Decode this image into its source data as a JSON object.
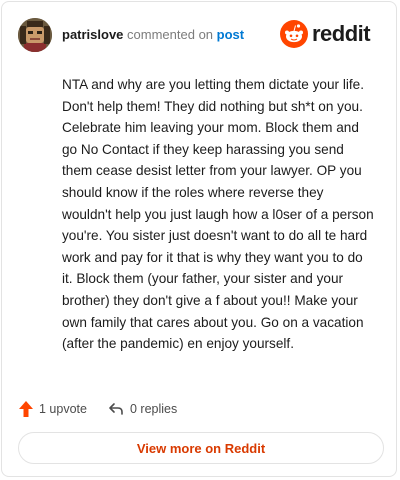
{
  "header": {
    "username": "patrislove",
    "action_text": "commented on",
    "post_link": "post",
    "brand_name": "reddit",
    "brand_color": "#ff4500"
  },
  "comment": {
    "text": "NTA and why are you letting them dictate your life. Don't help them! They did nothing but sh*t on you. Celebrate him leaving your mom. Block them and go No Contact if they keep harassing you send them cease desist letter from your lawyer. OP you should know if the roles where reverse they wouldn't help you just laugh how a l0ser of a person you're. You sister just doesn't want to do all te hard work and pay for it that is why they want you to do it. Block them (your father, your sister and your brother) they don't give a f about you!! Make your own family that cares about you. Go on a vacation (after the pandemic) en enjoy yourself."
  },
  "actions": {
    "upvote_label": "1 upvote",
    "upvote_icon": "upvote-arrow-icon",
    "reply_label": "0 replies",
    "reply_icon": "reply-arrow-icon"
  },
  "footer": {
    "view_more_label": "View more on Reddit",
    "accent_color": "#d93a00"
  }
}
